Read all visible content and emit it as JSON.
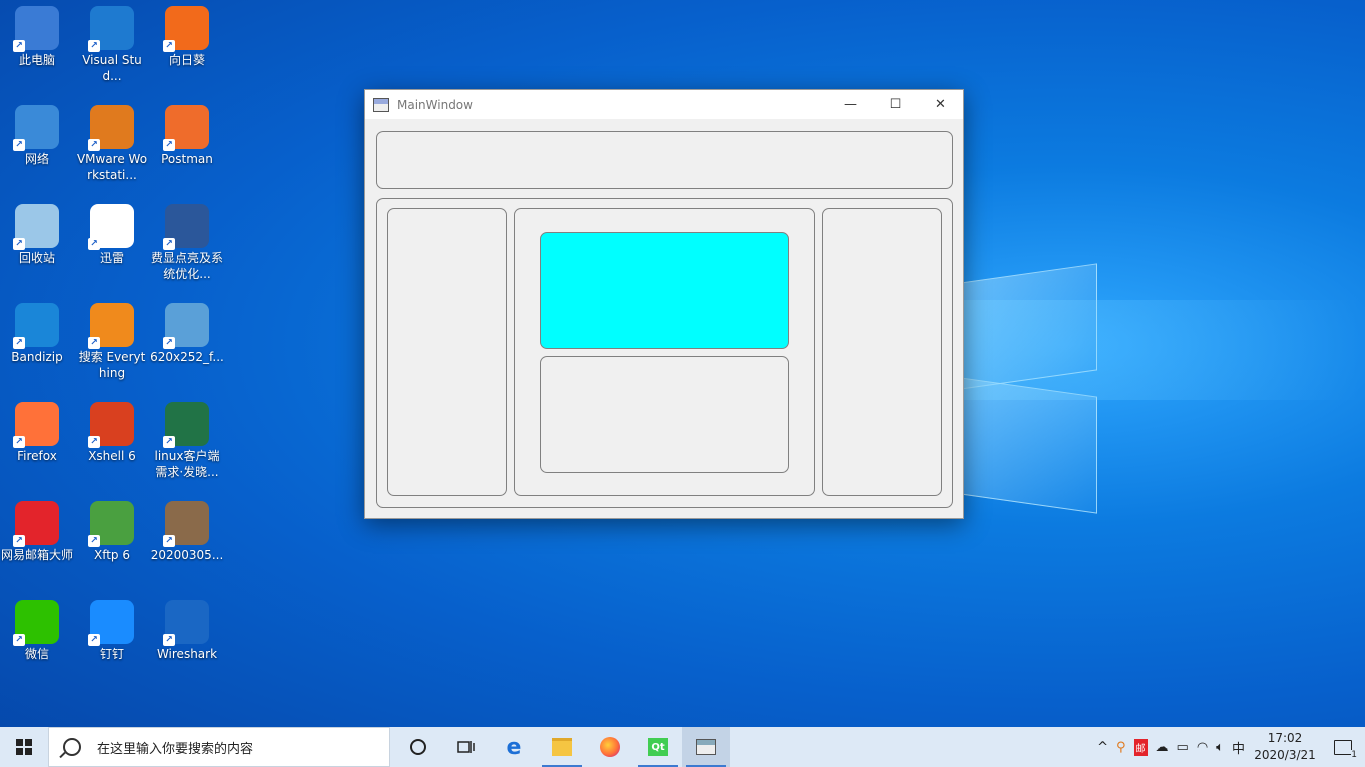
{
  "desktop_icons": [
    {
      "label": "此电脑",
      "icon": "this-pc-icon",
      "color": "#3a7bd5"
    },
    {
      "label": "Visual Stud...",
      "icon": "vscode-icon",
      "color": "#1e7ad0"
    },
    {
      "label": "向日葵",
      "icon": "sunflower-icon",
      "color": "#f26a1b"
    },
    {
      "label": "网络",
      "icon": "network-icon",
      "color": "#3a8ad8"
    },
    {
      "label": "VMware Workstati...",
      "icon": "vmware-icon",
      "color": "#e07a1e"
    },
    {
      "label": "Postman",
      "icon": "postman-icon",
      "color": "#ef6c2b"
    },
    {
      "label": "回收站",
      "icon": "recycle-bin-icon",
      "color": "#9bc7e8"
    },
    {
      "label": "迅雷",
      "icon": "thunder-icon",
      "color": "#ffffff"
    },
    {
      "label": "费显点亮及系统优化...",
      "icon": "word-doc-icon",
      "color": "#2b579a"
    },
    {
      "label": "Bandizip",
      "icon": "bandizip-icon",
      "color": "#1a86d8"
    },
    {
      "label": "搜索 Everything",
      "icon": "everything-search-icon",
      "color": "#f08a1c"
    },
    {
      "label": "620x252_f...",
      "icon": "video-file-icon",
      "color": "#5aa0d8"
    },
    {
      "label": "Firefox",
      "icon": "firefox-icon",
      "color": "#ff7139"
    },
    {
      "label": "Xshell 6",
      "icon": "xshell-icon",
      "color": "#d9401f"
    },
    {
      "label": "linux客户端需求·发晓...",
      "icon": "excel-doc-icon",
      "color": "#217346"
    },
    {
      "label": "网易邮箱大师",
      "icon": "netease-mail-icon",
      "color": "#e3242b"
    },
    {
      "label": "Xftp 6",
      "icon": "xftp-icon",
      "color": "#4aa040"
    },
    {
      "label": "20200305...",
      "icon": "image-file-icon",
      "color": "#8a6a4a"
    },
    {
      "label": "微信",
      "icon": "wechat-icon",
      "color": "#2dc100"
    },
    {
      "label": "钉钉",
      "icon": "dingtalk-icon",
      "color": "#1a8cff"
    },
    {
      "label": "Wireshark",
      "icon": "wireshark-icon",
      "color": "#1a67c4"
    }
  ],
  "window": {
    "title": "MainWindow",
    "minimize": "—",
    "maximize": "☐",
    "close": "✕",
    "accent_cyan": "#00ffff"
  },
  "taskbar": {
    "search_placeholder": "在这里输入你要搜索的内容",
    "pinned": [
      "cortana-icon",
      "task-view-icon",
      "edge-icon",
      "file-explorer-icon",
      "firefox-icon",
      "qt-creator-icon",
      "mainwindow-app-icon"
    ],
    "tray": {
      "show_hidden": "^",
      "ime": "中",
      "time": "17:02",
      "date": "2020/3/21",
      "notification_count": "1"
    }
  }
}
